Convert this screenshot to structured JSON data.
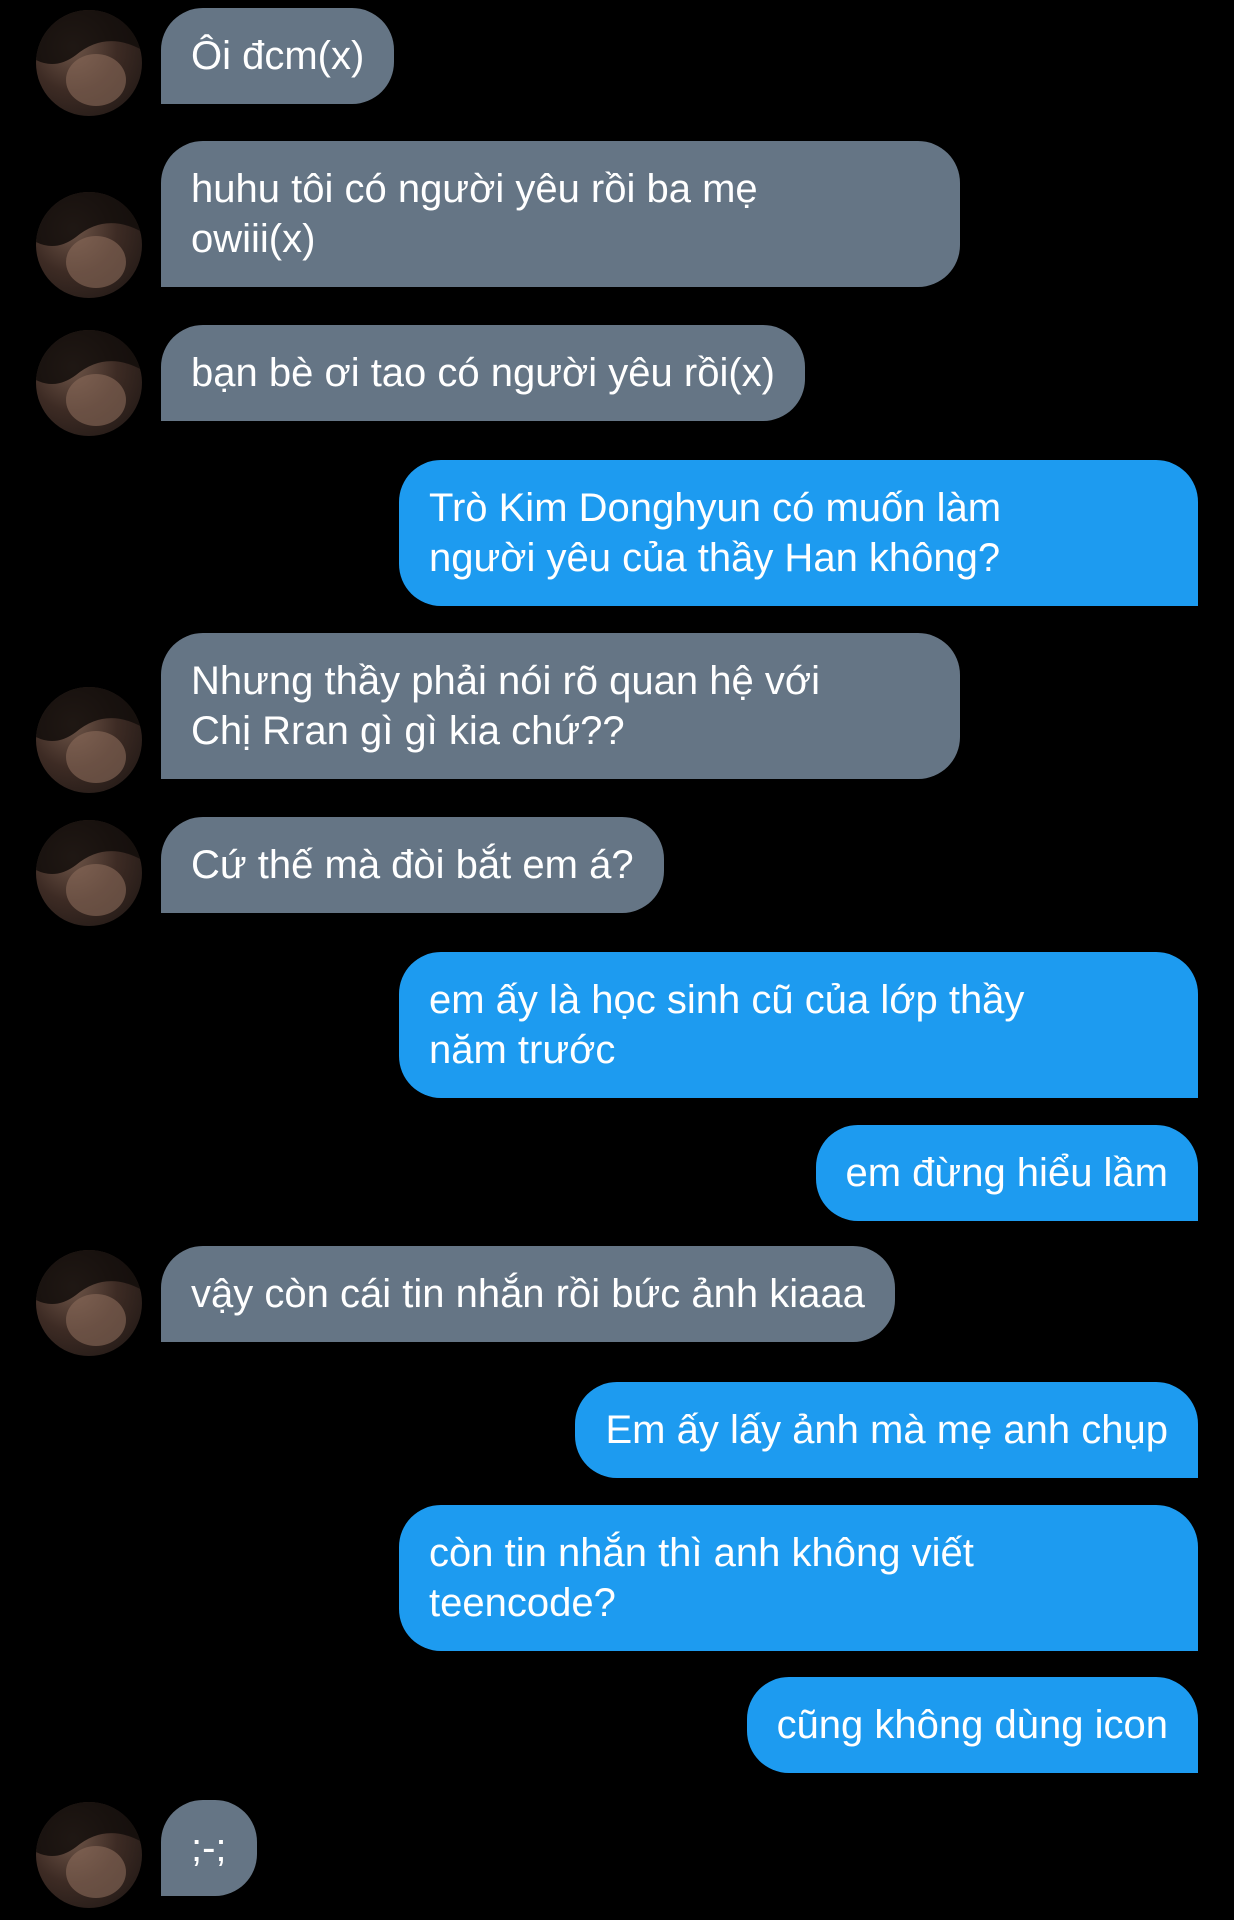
{
  "colors": {
    "background": "#000000",
    "incoming_bubble": "#657585",
    "outgoing_bubble": "#1d9bf0",
    "text": "#ffffff"
  },
  "avatar_icon": "user-photo-avatar",
  "messages": [
    {
      "side": "in",
      "lines": [
        "Ôi đcm(x)"
      ]
    },
    {
      "side": "in",
      "lines": [
        "huhu tôi có người yêu rồi ba mẹ",
        "owiii(x)"
      ]
    },
    {
      "side": "in",
      "lines": [
        "bạn bè ơi tao có người yêu rồi(x)"
      ]
    },
    {
      "side": "out",
      "lines": [
        "Trò Kim Donghyun có muốn làm",
        "người yêu của thầy Han không?"
      ]
    },
    {
      "side": "in",
      "lines": [
        "Nhưng thầy phải nói rõ quan hệ với",
        "Chị Rran gì gì kia chứ??"
      ]
    },
    {
      "side": "in",
      "lines": [
        "Cứ thế mà đòi bắt em á?"
      ]
    },
    {
      "side": "out",
      "lines": [
        "em ấy là học sinh cũ của lớp thầy",
        "năm trước"
      ]
    },
    {
      "side": "out",
      "lines": [
        "em đừng hiểu lầm"
      ]
    },
    {
      "side": "in",
      "lines": [
        "vậy còn cái tin nhắn rồi bức ảnh kiaaa"
      ]
    },
    {
      "side": "out",
      "lines": [
        "Em ấy lấy ảnh mà mẹ anh chụp"
      ]
    },
    {
      "side": "out",
      "lines": [
        "còn tin nhắn thì anh không viết",
        "teencode?"
      ]
    },
    {
      "side": "out",
      "lines": [
        "cũng không dùng icon"
      ]
    },
    {
      "side": "in",
      "lines": [
        ";-;"
      ]
    }
  ]
}
